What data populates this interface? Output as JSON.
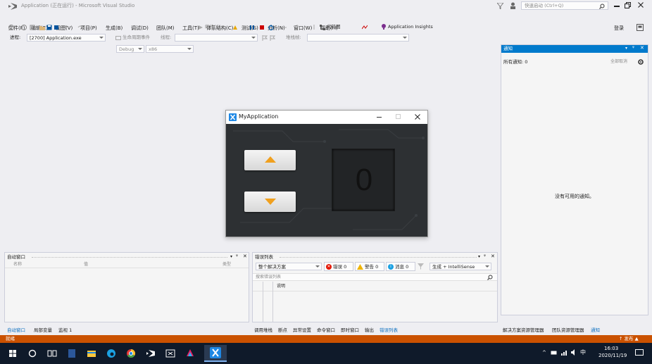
{
  "window": {
    "title": "Application (正在运行) - Microsoft Visual Studio",
    "quick_launch_placeholder": "快速启动 (Ctrl+Q)",
    "login": "登录"
  },
  "menu": [
    "文件(F)",
    "编辑(E)",
    "视图(V)",
    "项目(P)",
    "生成(B)",
    "调试(D)",
    "团队(M)",
    "工具(T)",
    "体系结构(C)",
    "测试(S)",
    "分析(N)",
    "窗口(W)",
    "帮助(H)"
  ],
  "toolbar": {
    "config": "Debug",
    "platform": "x86",
    "continue": "继续(C)",
    "code_map": "代码图",
    "app_insights": "Application Insights"
  },
  "debug_location": {
    "process_label": "进程:",
    "process_value": "[2700] Application.exe",
    "lifecycle": "生命周期事件",
    "thread_label": "线程:",
    "stack_label": "堆栈帧:"
  },
  "notifications": {
    "title": "通知",
    "count": "所有通知: 0",
    "dismiss_all": "全部取消",
    "empty": "没有可用的通知。",
    "tabs": [
      "解决方案资源管理器",
      "团队资源管理器",
      "通知"
    ]
  },
  "app_window": {
    "title": "MyApplication",
    "counter": "0"
  },
  "autos_panel": {
    "title": "自动窗口",
    "columns": [
      "名称",
      "值",
      "类型"
    ],
    "tabs": [
      "自动窗口",
      "局部变量",
      "监视 1"
    ]
  },
  "error_panel": {
    "title": "错误列表",
    "scope": "整个解决方案",
    "errors": "错误 0",
    "warnings": "警告 0",
    "messages": "消息 0",
    "build_filter": "生成 + IntelliSense",
    "search_placeholder": "搜索错误列表",
    "column": "说明",
    "tabs": [
      "调用堆栈",
      "断点",
      "异常设置",
      "命令窗口",
      "即时窗口",
      "输出",
      "错误列表"
    ]
  },
  "status": {
    "text": "就绪",
    "publish": "↑ 发布 ▲"
  },
  "taskbar": {
    "time": "16:03",
    "date": "2020/11/19",
    "ime": "中"
  },
  "colors": {
    "accent": "#007acc",
    "status": "#ca5100",
    "taskbar": "#0f1a2a",
    "arrow": "#f0a01e"
  }
}
